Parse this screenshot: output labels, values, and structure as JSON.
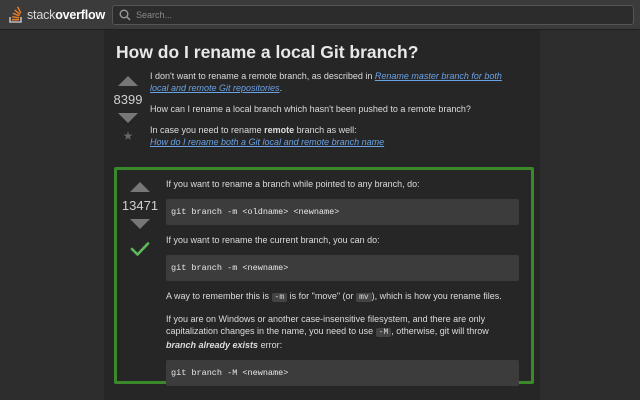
{
  "header": {
    "logo_light": "stack",
    "logo_bold": "overflow",
    "search_placeholder": "Search..."
  },
  "question": {
    "title": "How do I rename a local Git branch?",
    "votes": "8399",
    "p1_text": "I don't want to rename a remote branch, as described in ",
    "p1_link": "Rename master branch for both local and remote Git repositories",
    "p1_end": ".",
    "p2_text": "How can I rename a local branch which hasn't been pushed to a remote branch?",
    "p3_text_before": "In case you need to rename ",
    "p3_bold": "remote",
    "p3_text_after": " branch as well:",
    "p3_link": "How do I rename both a Git local and remote branch name"
  },
  "answer": {
    "votes": "13471",
    "p1": "If you want to rename a branch while pointed to any branch, do:",
    "code1": "git branch -m <oldname> <newname>",
    "p2": "If you want to rename the current branch, you can do:",
    "code2": "git branch -m <newname>",
    "p3_a": "A way to remember this is ",
    "p3_code1": "-m",
    "p3_b": " is for \"move\" (or ",
    "p3_code2": "mv",
    "p3_c": "), which is how you rename files.",
    "p4_a": "If you are on Windows or another case-insensitive filesystem, and there are only capitalization changes in the name, you need to use ",
    "p4_code": "-M",
    "p4_b": ", otherwise, git will throw ",
    "p4_bold": "branch already exists",
    "p4_c": " error:",
    "code3": "git branch -M <newname>"
  },
  "colors": {
    "accepted_border": "#3a8a2c",
    "link": "#6aa2e6",
    "accepted_check": "#5fb85a"
  }
}
